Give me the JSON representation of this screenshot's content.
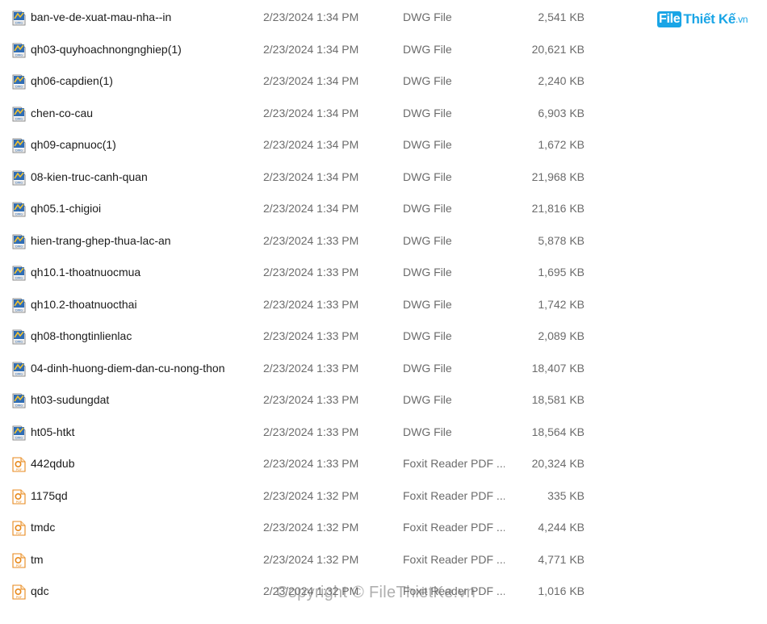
{
  "logo": {
    "file": "File",
    "thietke": "Thiết Kế",
    "vn": ".vn"
  },
  "watermark": "Copyright © FileThietKe.vn",
  "colors": {
    "accent": "#1aa5e6",
    "dwg_icon": "#2f6db5",
    "pdf_icon": "#e8891c",
    "text": "#1b1b1b",
    "muted": "#6b6b6b"
  },
  "files": [
    {
      "icon": "dwg-file-icon",
      "name": "ban-ve-de-xuat-mau-nha--in",
      "date": "2/23/2024 1:34 PM",
      "type": "DWG File",
      "size": "2,541 KB"
    },
    {
      "icon": "dwg-file-icon",
      "name": "qh03-quyhoachnongnghiep(1)",
      "date": "2/23/2024 1:34 PM",
      "type": "DWG File",
      "size": "20,621 KB"
    },
    {
      "icon": "dwg-file-icon",
      "name": "qh06-capdien(1)",
      "date": "2/23/2024 1:34 PM",
      "type": "DWG File",
      "size": "2,240 KB"
    },
    {
      "icon": "dwg-file-icon",
      "name": "chen-co-cau",
      "date": "2/23/2024 1:34 PM",
      "type": "DWG File",
      "size": "6,903 KB"
    },
    {
      "icon": "dwg-file-icon",
      "name": "qh09-capnuoc(1)",
      "date": "2/23/2024 1:34 PM",
      "type": "DWG File",
      "size": "1,672 KB"
    },
    {
      "icon": "dwg-file-icon",
      "name": "08-kien-truc-canh-quan",
      "date": "2/23/2024 1:34 PM",
      "type": "DWG File",
      "size": "21,968 KB"
    },
    {
      "icon": "dwg-file-icon",
      "name": "qh05.1-chigioi",
      "date": "2/23/2024 1:34 PM",
      "type": "DWG File",
      "size": "21,816 KB"
    },
    {
      "icon": "dwg-file-icon",
      "name": "hien-trang-ghep-thua-lac-an",
      "date": "2/23/2024 1:33 PM",
      "type": "DWG File",
      "size": "5,878 KB"
    },
    {
      "icon": "dwg-file-icon",
      "name": "qh10.1-thoatnuocmua",
      "date": "2/23/2024 1:33 PM",
      "type": "DWG File",
      "size": "1,695 KB"
    },
    {
      "icon": "dwg-file-icon",
      "name": "qh10.2-thoatnuocthai",
      "date": "2/23/2024 1:33 PM",
      "type": "DWG File",
      "size": "1,742 KB"
    },
    {
      "icon": "dwg-file-icon",
      "name": "qh08-thongtinlienlac",
      "date": "2/23/2024 1:33 PM",
      "type": "DWG File",
      "size": "2,089 KB"
    },
    {
      "icon": "dwg-file-icon",
      "name": "04-dinh-huong-diem-dan-cu-nong-thon",
      "date": "2/23/2024 1:33 PM",
      "type": "DWG File",
      "size": "18,407 KB"
    },
    {
      "icon": "dwg-file-icon",
      "name": "ht03-sudungdat",
      "date": "2/23/2024 1:33 PM",
      "type": "DWG File",
      "size": "18,581 KB"
    },
    {
      "icon": "dwg-file-icon",
      "name": "ht05-htkt",
      "date": "2/23/2024 1:33 PM",
      "type": "DWG File",
      "size": "18,564 KB"
    },
    {
      "icon": "pdf-file-icon",
      "name": "442qdub",
      "date": "2/23/2024 1:33 PM",
      "type": "Foxit Reader PDF ...",
      "size": "20,324 KB"
    },
    {
      "icon": "pdf-file-icon",
      "name": "1175qd",
      "date": "2/23/2024 1:32 PM",
      "type": "Foxit Reader PDF ...",
      "size": "335 KB"
    },
    {
      "icon": "pdf-file-icon",
      "name": "tmdc",
      "date": "2/23/2024 1:32 PM",
      "type": "Foxit Reader PDF ...",
      "size": "4,244 KB"
    },
    {
      "icon": "pdf-file-icon",
      "name": "tm",
      "date": "2/23/2024 1:32 PM",
      "type": "Foxit Reader PDF ...",
      "size": "4,771 KB"
    },
    {
      "icon": "pdf-file-icon",
      "name": "qdc",
      "date": "2/23/2024 1:32 PM",
      "type": "Foxit Reader PDF ...",
      "size": "1,016 KB"
    }
  ]
}
